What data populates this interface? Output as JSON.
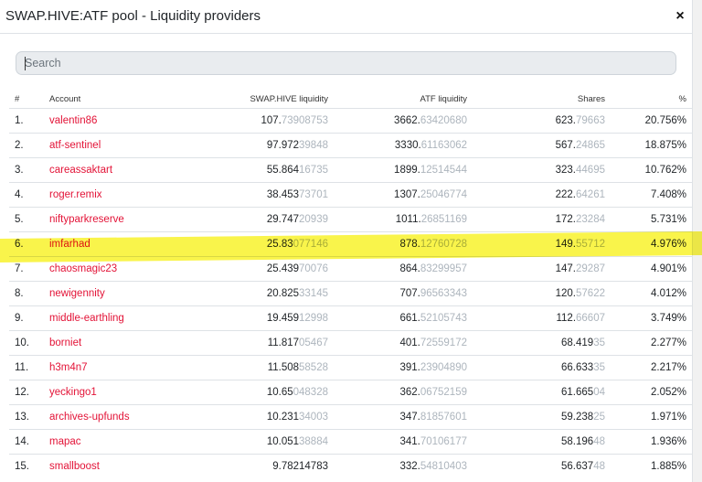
{
  "modal": {
    "title": "SWAP.HIVE:ATF pool - Liquidity providers",
    "close_label": "×"
  },
  "search": {
    "placeholder": "Search"
  },
  "columns": [
    "#",
    "Account",
    "SWAP.HIVE liquidity",
    "ATF liquidity",
    "Shares",
    "%"
  ],
  "rows": [
    {
      "rank": "1.",
      "account": "valentin86",
      "swap_main": "107.",
      "swap_faint": "73908753",
      "atf_main": "3662.",
      "atf_faint": "63420680",
      "shares_main": "623.",
      "shares_faint": "79663",
      "pct": "20.756%"
    },
    {
      "rank": "2.",
      "account": "atf-sentinel",
      "swap_main": "97.972",
      "swap_faint": "39848",
      "atf_main": "3330.",
      "atf_faint": "61163062",
      "shares_main": "567.",
      "shares_faint": "24865",
      "pct": "18.875%"
    },
    {
      "rank": "3.",
      "account": "careassaktart",
      "swap_main": "55.864",
      "swap_faint": "16735",
      "atf_main": "1899.",
      "atf_faint": "12514544",
      "shares_main": "323.",
      "shares_faint": "44695",
      "pct": "10.762%"
    },
    {
      "rank": "4.",
      "account": "roger.remix",
      "swap_main": "38.453",
      "swap_faint": "73701",
      "atf_main": "1307.",
      "atf_faint": "25046774",
      "shares_main": "222.",
      "shares_faint": "64261",
      "pct": "7.408%"
    },
    {
      "rank": "5.",
      "account": "niftyparkreserve",
      "swap_main": "29.747",
      "swap_faint": "20939",
      "atf_main": "1011.",
      "atf_faint": "26851169",
      "shares_main": "172.",
      "shares_faint": "23284",
      "pct": "5.731%"
    },
    {
      "rank": "6.",
      "account": "imfarhad",
      "swap_main": "25.83",
      "swap_faint": "077146",
      "atf_main": "878.",
      "atf_faint": "12760728",
      "shares_main": "149.",
      "shares_faint": "55712",
      "pct": "4.976%"
    },
    {
      "rank": "7.",
      "account": "chaosmagic23",
      "swap_main": "25.439",
      "swap_faint": "70076",
      "atf_main": "864.",
      "atf_faint": "83299957",
      "shares_main": "147.",
      "shares_faint": "29287",
      "pct": "4.901%"
    },
    {
      "rank": "8.",
      "account": "newigennity",
      "swap_main": "20.825",
      "swap_faint": "33145",
      "atf_main": "707.",
      "atf_faint": "96563343",
      "shares_main": "120.",
      "shares_faint": "57622",
      "pct": "4.012%"
    },
    {
      "rank": "9.",
      "account": "middle-earthling",
      "swap_main": "19.459",
      "swap_faint": "12998",
      "atf_main": "661.",
      "atf_faint": "52105743",
      "shares_main": "112.",
      "shares_faint": "66607",
      "pct": "3.749%"
    },
    {
      "rank": "10.",
      "account": "borniet",
      "swap_main": "11.817",
      "swap_faint": "05467",
      "atf_main": "401.",
      "atf_faint": "72559172",
      "shares_main": "68.419",
      "shares_faint": "35",
      "pct": "2.277%"
    },
    {
      "rank": "11.",
      "account": "h3m4n7",
      "swap_main": "11.508",
      "swap_faint": "58528",
      "atf_main": "391.",
      "atf_faint": "23904890",
      "shares_main": "66.633",
      "shares_faint": "35",
      "pct": "2.217%"
    },
    {
      "rank": "12.",
      "account": "yeckingo1",
      "swap_main": "10.65",
      "swap_faint": "048328",
      "atf_main": "362.",
      "atf_faint": "06752159",
      "shares_main": "61.665",
      "shares_faint": "04",
      "pct": "2.052%"
    },
    {
      "rank": "13.",
      "account": "archives-upfunds",
      "swap_main": "10.231",
      "swap_faint": "34003",
      "atf_main": "347.",
      "atf_faint": "81857601",
      "shares_main": "59.238",
      "shares_faint": "25",
      "pct": "1.971%"
    },
    {
      "rank": "14.",
      "account": "mapac",
      "swap_main": "10.051",
      "swap_faint": "38884",
      "atf_main": "341.",
      "atf_faint": "70106177",
      "shares_main": "58.196",
      "shares_faint": "48",
      "pct": "1.936%"
    },
    {
      "rank": "15.",
      "account": "smallboost",
      "swap_main": "9.78214783",
      "swap_faint": "",
      "atf_main": "332.",
      "atf_faint": "54810403",
      "shares_main": "56.637",
      "shares_faint": "48",
      "pct": "1.885%"
    }
  ],
  "highlighted_row": "6.",
  "colors": {
    "accent": "#e31337",
    "faint": "#adb5bd",
    "highlight": "#f8f32b"
  }
}
